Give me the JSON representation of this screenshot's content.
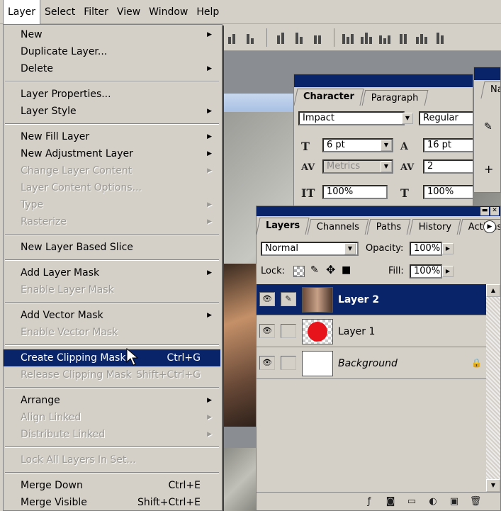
{
  "menubar": [
    "Layer",
    "Select",
    "Filter",
    "View",
    "Window",
    "Help"
  ],
  "layer_menu": {
    "groups": [
      [
        {
          "label": "New",
          "submenu": true
        },
        {
          "label": "Duplicate Layer..."
        },
        {
          "label": "Delete",
          "submenu": true
        }
      ],
      [
        {
          "label": "Layer Properties..."
        },
        {
          "label": "Layer Style",
          "submenu": true
        }
      ],
      [
        {
          "label": "New Fill Layer",
          "submenu": true
        },
        {
          "label": "New Adjustment Layer",
          "submenu": true
        },
        {
          "label": "Change Layer Content",
          "submenu": true,
          "disabled": true
        },
        {
          "label": "Layer Content Options...",
          "disabled": true
        },
        {
          "label": "Type",
          "submenu": true,
          "disabled": true
        },
        {
          "label": "Rasterize",
          "submenu": true,
          "disabled": true
        }
      ],
      [
        {
          "label": "New Layer Based Slice"
        }
      ],
      [
        {
          "label": "Add Layer Mask",
          "submenu": true
        },
        {
          "label": "Enable Layer Mask",
          "disabled": true
        }
      ],
      [
        {
          "label": "Add Vector Mask",
          "submenu": true
        },
        {
          "label": "Enable Vector Mask",
          "disabled": true
        }
      ],
      [
        {
          "label": "Create Clipping Mask",
          "shortcut": "Ctrl+G",
          "highlight": true
        },
        {
          "label": "Release Clipping Mask",
          "shortcut": "Shift+Ctrl+G",
          "disabled": true
        }
      ],
      [
        {
          "label": "Arrange",
          "submenu": true
        },
        {
          "label": "Align Linked",
          "submenu": true,
          "disabled": true
        },
        {
          "label": "Distribute Linked",
          "submenu": true,
          "disabled": true
        }
      ],
      [
        {
          "label": "Lock All Layers In Set...",
          "disabled": true
        }
      ],
      [
        {
          "label": "Merge Down",
          "shortcut": "Ctrl+E"
        },
        {
          "label": "Merge Visible",
          "shortcut": "Shift+Ctrl+E"
        }
      ]
    ]
  },
  "character_panel": {
    "tabs": [
      "Character",
      "Paragraph"
    ],
    "font_family": "Impact",
    "font_style": "Regular",
    "font_size": "6 pt",
    "leading": "16 pt",
    "kerning": "Metrics",
    "tracking": "2",
    "vertical_scale": "100%",
    "horizontal_scale": "100%"
  },
  "navigator_panel": {
    "tab": "Na"
  },
  "layers_panel": {
    "tabs": [
      "Layers",
      "Channels",
      "Paths",
      "History",
      "Actions"
    ],
    "blend_mode": "Normal",
    "opacity_label": "Opacity:",
    "opacity": "100%",
    "lock_label": "Lock:",
    "fill_label": "Fill:",
    "fill": "100%",
    "layers": [
      {
        "name": "Layer 2",
        "selected": true
      },
      {
        "name": "Layer 1"
      },
      {
        "name": "Background",
        "locked": true
      }
    ]
  }
}
